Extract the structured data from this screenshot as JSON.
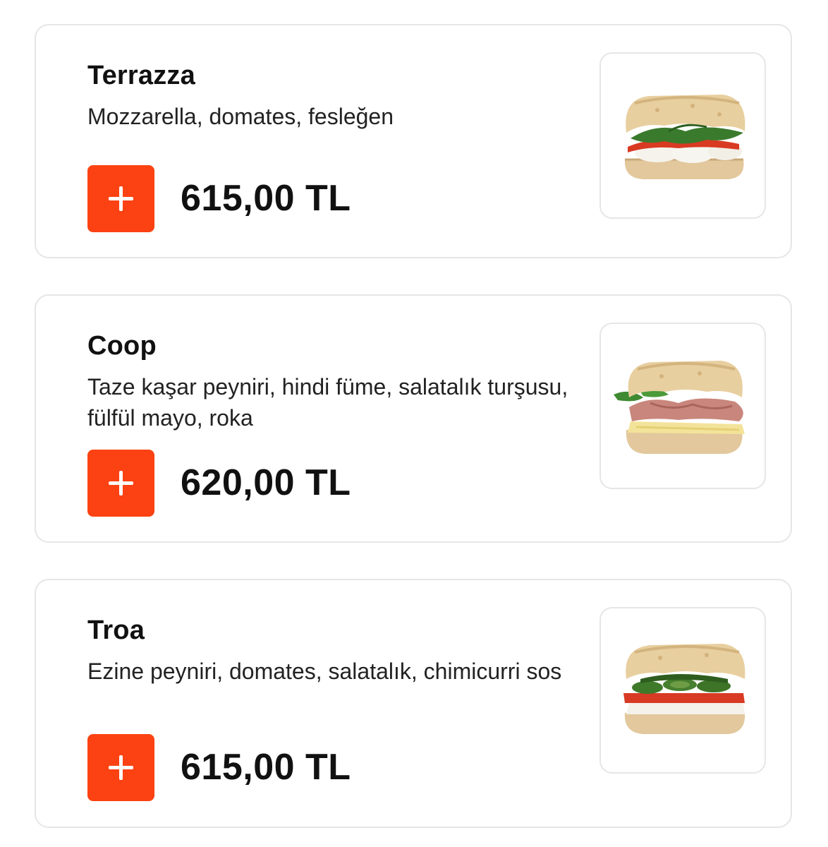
{
  "products": [
    {
      "name": "Terrazza",
      "description": "Mozzarella, domates, fesleğen",
      "price": "615,00 TL",
      "add_icon": "plus-icon",
      "image_alt": "sandwich-image"
    },
    {
      "name": "Coop",
      "description": "Taze kaşar peyniri, hindi füme, salatalık turşusu, fülfül mayo, roka",
      "price": "620,00 TL",
      "add_icon": "plus-icon",
      "image_alt": "sandwich-image"
    },
    {
      "name": "Troa",
      "description": "Ezine peyniri, domates, salatalık, chimicurri sos",
      "price": "615,00 TL",
      "add_icon": "plus-icon",
      "image_alt": "sandwich-image"
    }
  ],
  "colors": {
    "accent": "#fc4212",
    "card_border": "#e6e6e9",
    "text": "#111111"
  }
}
